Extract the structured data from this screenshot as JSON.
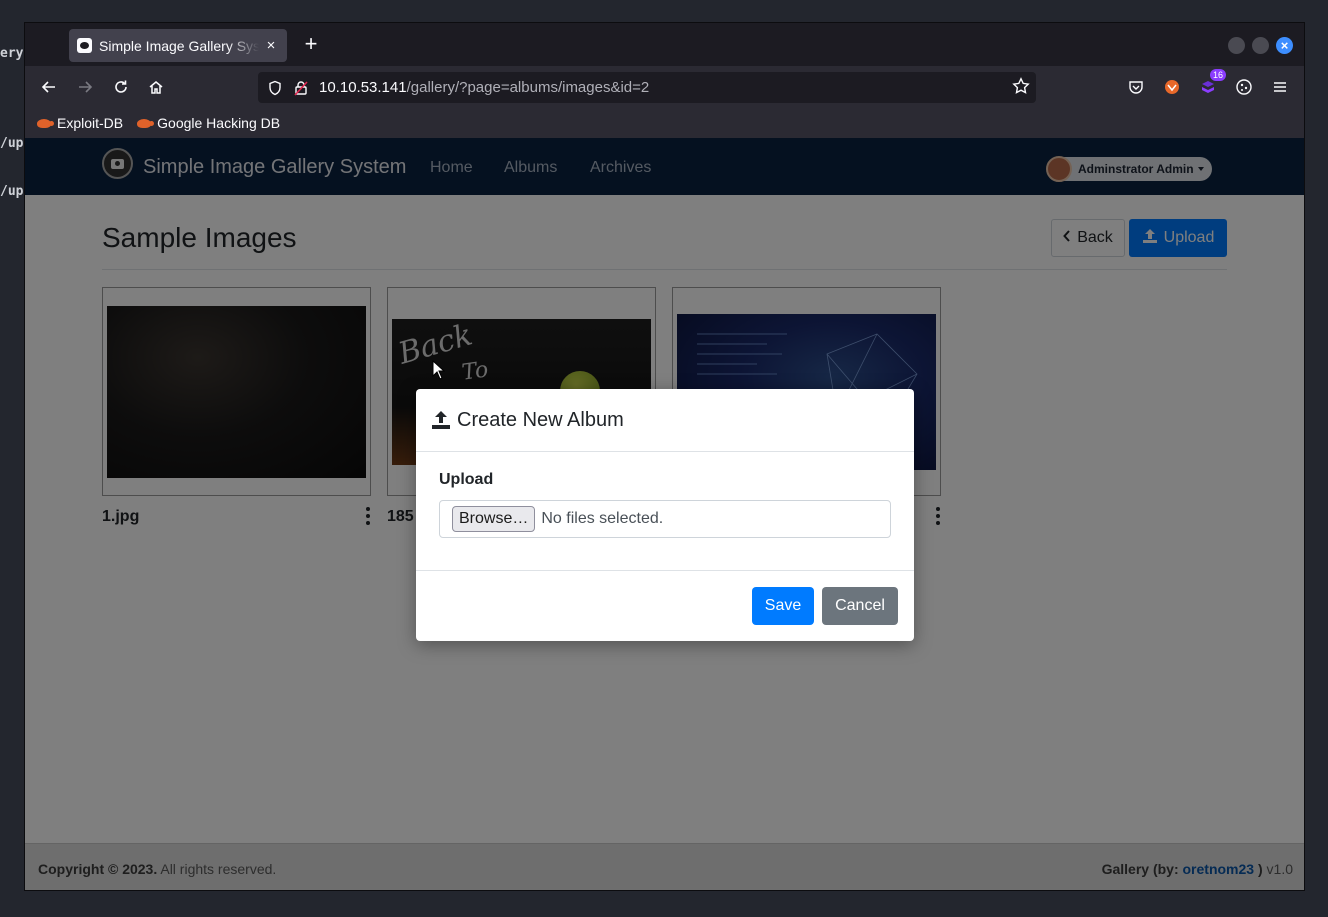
{
  "desktop": {
    "left_fragments": [
      "ery",
      "/up",
      "/up"
    ]
  },
  "browser": {
    "tab_title": "Simple Image Gallery System",
    "tab_close": "×",
    "new_tab": "+",
    "url_host": "10.10.53.141",
    "url_path": "/gallery/?page=albums/images&id=2",
    "extension_badge": "16",
    "bookmarks": [
      {
        "label": "Exploit-DB"
      },
      {
        "label": "Google Hacking DB"
      }
    ]
  },
  "site": {
    "brand": "Simple Image Gallery System",
    "nav": [
      "Home",
      "Albums",
      "Archives"
    ],
    "user": "Adminstrator Admin"
  },
  "page": {
    "title": "Sample Images",
    "back_label": "Back",
    "upload_label": "Upload",
    "images": [
      {
        "label": "1.jpg"
      },
      {
        "label": "185"
      },
      {
        "label": ""
      }
    ]
  },
  "modal": {
    "title": "Create New Album",
    "field_label": "Upload",
    "browse_label": "Browse…",
    "file_status": "No files selected.",
    "save_label": "Save",
    "cancel_label": "Cancel"
  },
  "footer": {
    "copyright_bold": "Copyright © 2023.",
    "copyright_rest": " All rights reserved.",
    "credit_prefix": "Gallery (by: ",
    "credit_author": "oretnom23",
    "credit_suffix": " )",
    "version": " v1.0"
  },
  "colors": {
    "site_nav": "#0b2240",
    "primary": "#007bff",
    "secondary": "#6c757d",
    "footer_link": "#0b56a8"
  }
}
